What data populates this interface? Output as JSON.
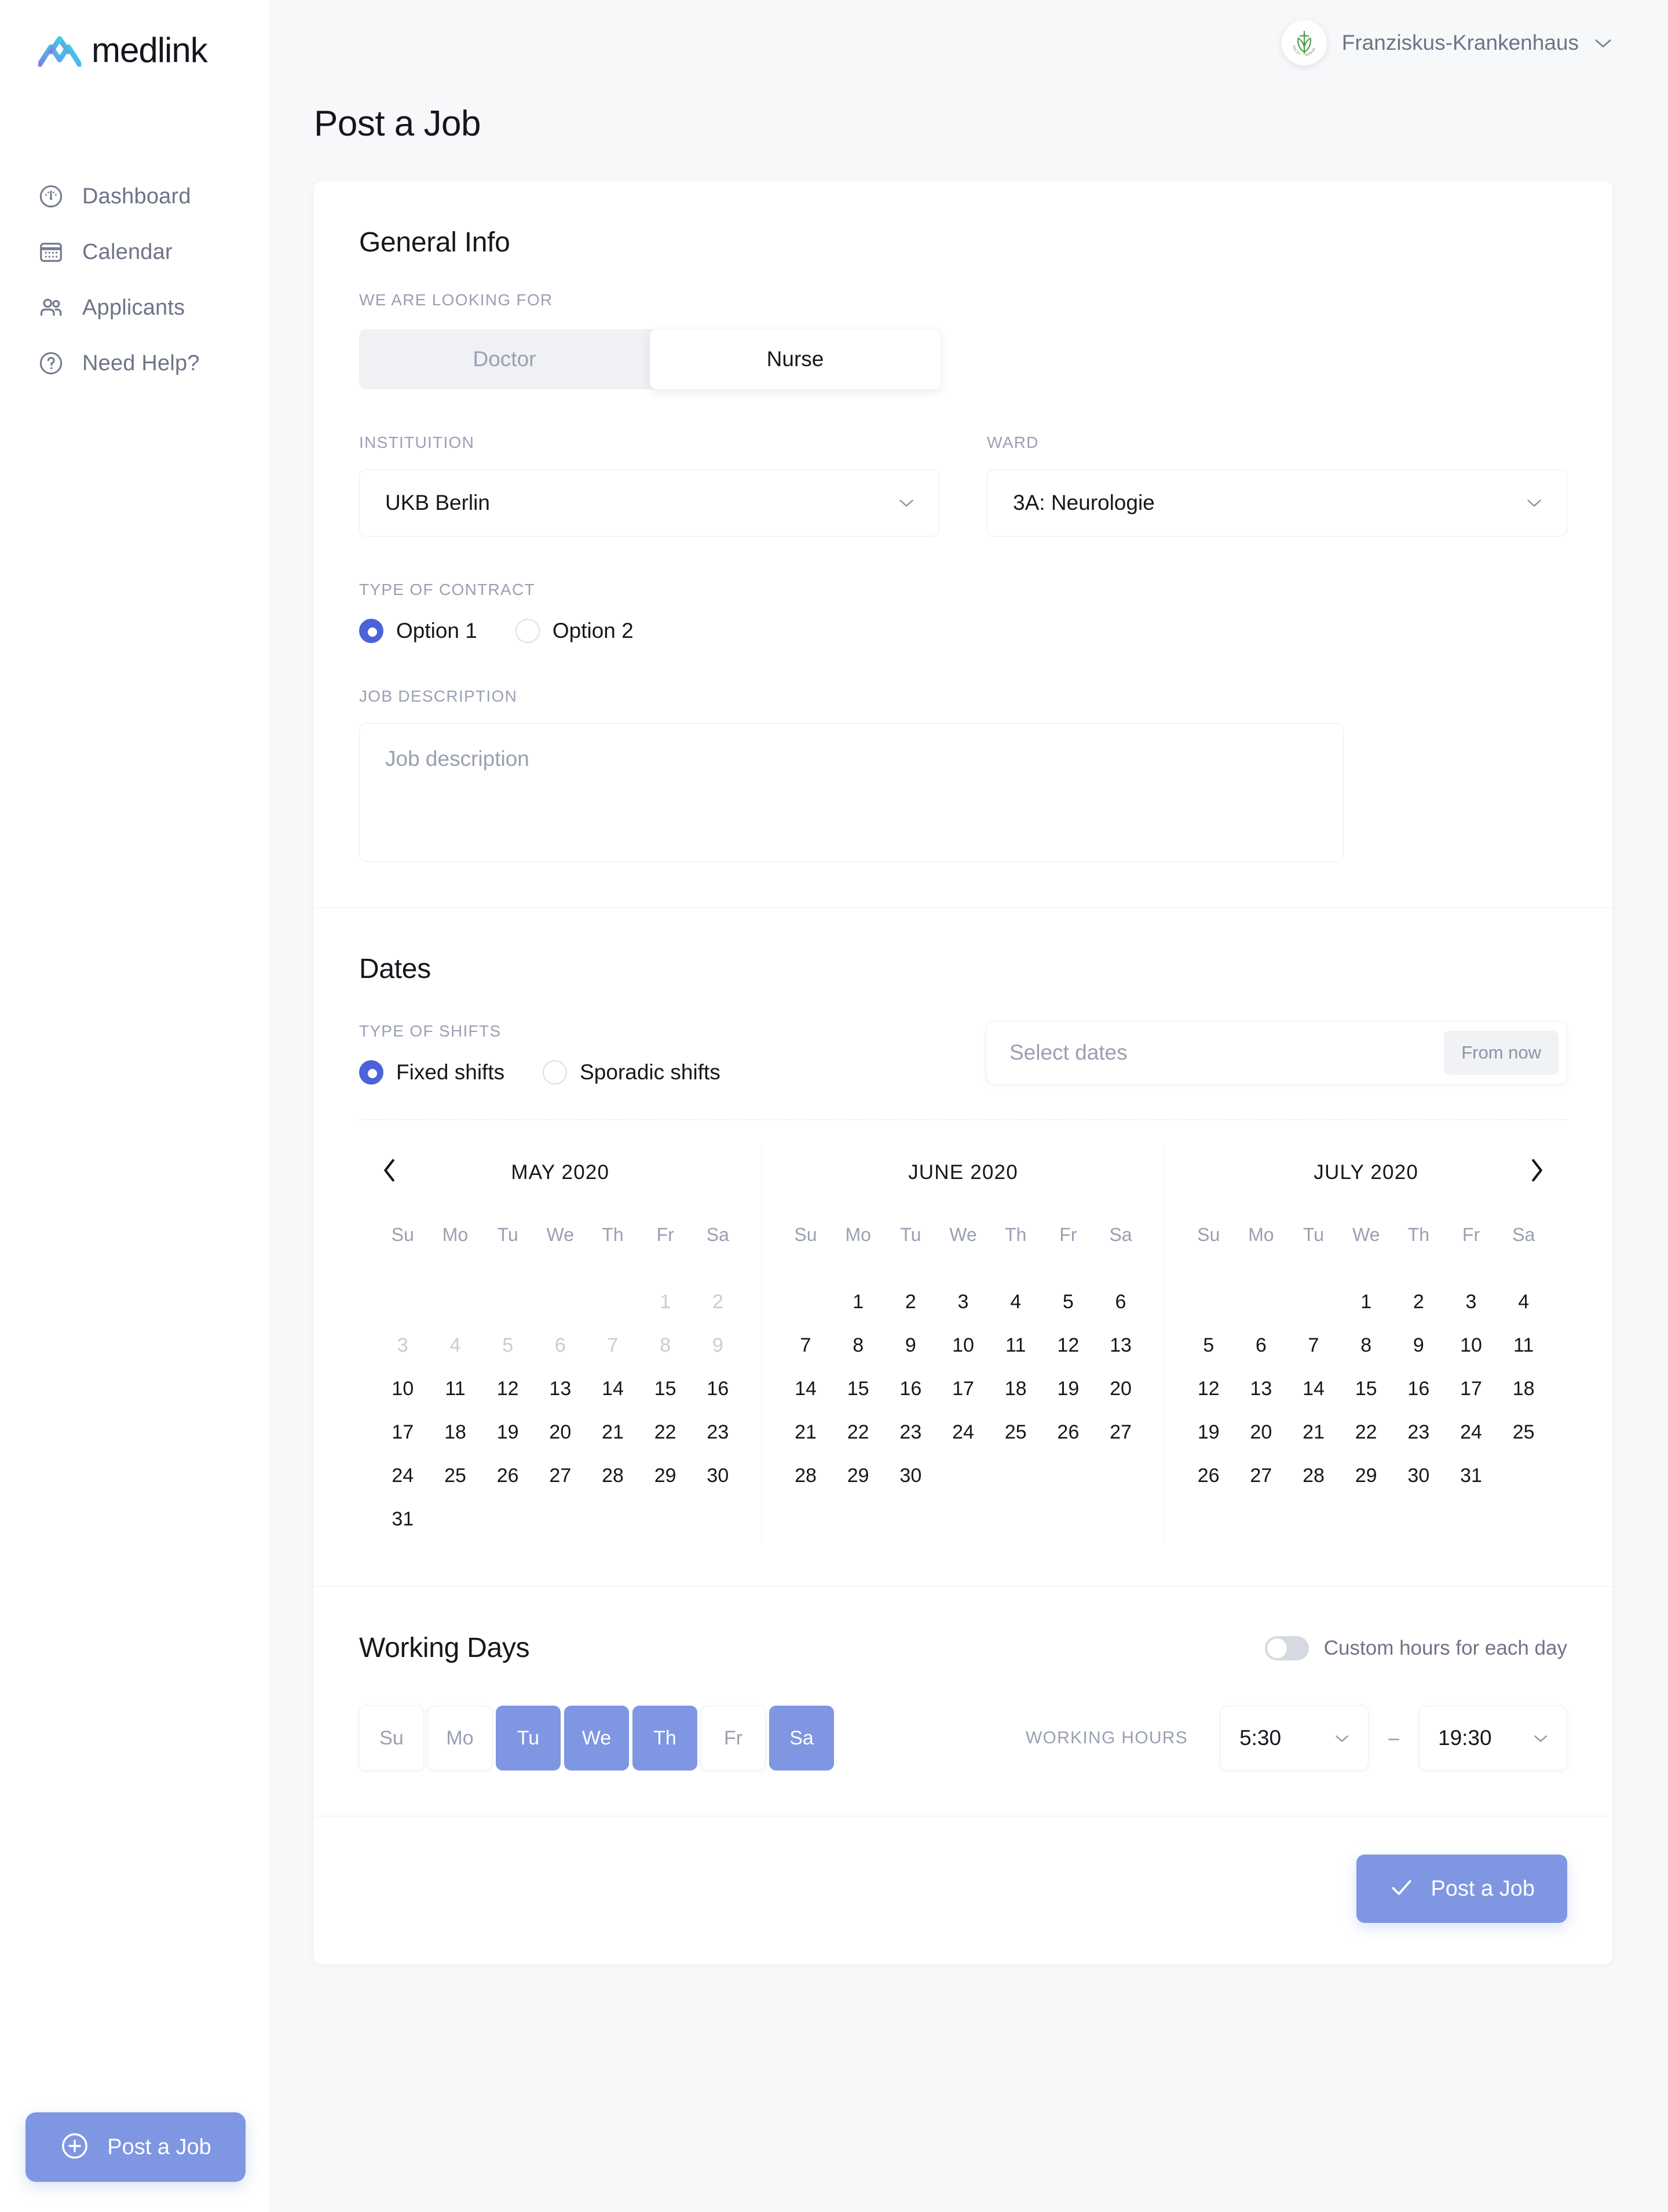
{
  "brand": {
    "name": "medlink",
    "accent": "#7f96e3",
    "logo_icon": "medlink-mountain-logo"
  },
  "sidebar": {
    "items": [
      {
        "label": "Dashboard",
        "icon": "gauge-icon"
      },
      {
        "label": "Calendar",
        "icon": "calendar-icon"
      },
      {
        "label": "Applicants",
        "icon": "users-icon"
      },
      {
        "label": "Need Help?",
        "icon": "question-circle-icon"
      }
    ],
    "post_job_label": "Post a Job",
    "post_job_icon": "plus-circle-icon"
  },
  "topbar": {
    "account_name": "Franziskus-Krankenhaus",
    "avatar_icon": "hospital-crest-avatar",
    "caret_icon": "chevron-down-icon"
  },
  "page": {
    "title": "Post a Job"
  },
  "general": {
    "section_title": "General Info",
    "looking_for_label": "WE ARE LOOKING FOR",
    "segments": [
      {
        "label": "Doctor",
        "active": false
      },
      {
        "label": "Nurse",
        "active": true
      }
    ],
    "institution_label": "INSTITUITION",
    "institution_value": "UKB Berlin",
    "ward_label": "WARD",
    "ward_value": "3A: Neurologie",
    "contract_label": "TYPE OF CONTRACT",
    "contract_options": [
      {
        "label": "Option 1",
        "selected": true
      },
      {
        "label": "Option 2",
        "selected": false
      }
    ],
    "description_label": "JOB DESCRIPTION",
    "description_placeholder": "Job description",
    "description_value": ""
  },
  "dates": {
    "section_title": "Dates",
    "shifts_label": "TYPE OF SHIFTS",
    "shift_options": [
      {
        "label": "Fixed shifts",
        "selected": true
      },
      {
        "label": "Sporadic shifts",
        "selected": false
      }
    ],
    "select_dates_placeholder": "Select dates",
    "from_now_label": "From now",
    "prev_icon": "chevron-left-icon",
    "next_icon": "chevron-right-icon",
    "dow": [
      "Su",
      "Mo",
      "Tu",
      "We",
      "Th",
      "Fr",
      "Sa"
    ],
    "months": [
      {
        "title": "MAY 2020",
        "lead_blanks": 5,
        "days": [
          {
            "n": 1,
            "muted": true
          },
          {
            "n": 2,
            "muted": true
          },
          {
            "n": 3,
            "muted": true
          },
          {
            "n": 4,
            "muted": true
          },
          {
            "n": 5,
            "muted": true
          },
          {
            "n": 6,
            "muted": true
          },
          {
            "n": 7,
            "muted": true
          },
          {
            "n": 8,
            "muted": true
          },
          {
            "n": 9,
            "muted": true
          },
          {
            "n": 10,
            "muted": false
          },
          {
            "n": 11,
            "muted": false
          },
          {
            "n": 12,
            "muted": false
          },
          {
            "n": 13,
            "muted": false
          },
          {
            "n": 14,
            "muted": false
          },
          {
            "n": 15,
            "muted": false
          },
          {
            "n": 16,
            "muted": false
          },
          {
            "n": 17,
            "muted": false
          },
          {
            "n": 18,
            "muted": false
          },
          {
            "n": 19,
            "muted": false
          },
          {
            "n": 20,
            "muted": false
          },
          {
            "n": 21,
            "muted": false
          },
          {
            "n": 22,
            "muted": false
          },
          {
            "n": 23,
            "muted": false
          },
          {
            "n": 24,
            "muted": false
          },
          {
            "n": 25,
            "muted": false
          },
          {
            "n": 26,
            "muted": false
          },
          {
            "n": 27,
            "muted": false
          },
          {
            "n": 28,
            "muted": false
          },
          {
            "n": 29,
            "muted": false
          },
          {
            "n": 30,
            "muted": false
          },
          {
            "n": 31,
            "muted": false
          }
        ]
      },
      {
        "title": "JUNE 2020",
        "lead_blanks": 1,
        "days": [
          {
            "n": 1,
            "muted": false
          },
          {
            "n": 2,
            "muted": false
          },
          {
            "n": 3,
            "muted": false
          },
          {
            "n": 4,
            "muted": false
          },
          {
            "n": 5,
            "muted": false
          },
          {
            "n": 6,
            "muted": false
          },
          {
            "n": 7,
            "muted": false
          },
          {
            "n": 8,
            "muted": false
          },
          {
            "n": 9,
            "muted": false
          },
          {
            "n": 10,
            "muted": false
          },
          {
            "n": 11,
            "muted": false
          },
          {
            "n": 12,
            "muted": false
          },
          {
            "n": 13,
            "muted": false
          },
          {
            "n": 14,
            "muted": false
          },
          {
            "n": 15,
            "muted": false
          },
          {
            "n": 16,
            "muted": false
          },
          {
            "n": 17,
            "muted": false
          },
          {
            "n": 18,
            "muted": false
          },
          {
            "n": 19,
            "muted": false
          },
          {
            "n": 20,
            "muted": false
          },
          {
            "n": 21,
            "muted": false
          },
          {
            "n": 22,
            "muted": false
          },
          {
            "n": 23,
            "muted": false
          },
          {
            "n": 24,
            "muted": false
          },
          {
            "n": 25,
            "muted": false
          },
          {
            "n": 26,
            "muted": false
          },
          {
            "n": 27,
            "muted": false
          },
          {
            "n": 28,
            "muted": false
          },
          {
            "n": 29,
            "muted": false
          },
          {
            "n": 30,
            "muted": false
          }
        ]
      },
      {
        "title": "JULY 2020",
        "lead_blanks": 3,
        "days": [
          {
            "n": 1,
            "muted": false
          },
          {
            "n": 2,
            "muted": false
          },
          {
            "n": 3,
            "muted": false
          },
          {
            "n": 4,
            "muted": false
          },
          {
            "n": 5,
            "muted": false
          },
          {
            "n": 6,
            "muted": false
          },
          {
            "n": 7,
            "muted": false
          },
          {
            "n": 8,
            "muted": false
          },
          {
            "n": 9,
            "muted": false
          },
          {
            "n": 10,
            "muted": false
          },
          {
            "n": 11,
            "muted": false
          },
          {
            "n": 12,
            "muted": false
          },
          {
            "n": 13,
            "muted": false
          },
          {
            "n": 14,
            "muted": false
          },
          {
            "n": 15,
            "muted": false
          },
          {
            "n": 16,
            "muted": false
          },
          {
            "n": 17,
            "muted": false
          },
          {
            "n": 18,
            "muted": false
          },
          {
            "n": 19,
            "muted": false
          },
          {
            "n": 20,
            "muted": false
          },
          {
            "n": 21,
            "muted": false
          },
          {
            "n": 22,
            "muted": false
          },
          {
            "n": 23,
            "muted": false
          },
          {
            "n": 24,
            "muted": false
          },
          {
            "n": 25,
            "muted": false
          },
          {
            "n": 26,
            "muted": false
          },
          {
            "n": 27,
            "muted": false
          },
          {
            "n": 28,
            "muted": false
          },
          {
            "n": 29,
            "muted": false
          },
          {
            "n": 30,
            "muted": false
          },
          {
            "n": 31,
            "muted": false
          }
        ]
      }
    ]
  },
  "working": {
    "section_title": "Working Days",
    "custom_hours_label": "Custom hours for each day",
    "custom_hours_on": false,
    "days": [
      {
        "label": "Su",
        "selected": false
      },
      {
        "label": "Mo",
        "selected": false
      },
      {
        "label": "Tu",
        "selected": true
      },
      {
        "label": "We",
        "selected": true
      },
      {
        "label": "Th",
        "selected": true
      },
      {
        "label": "Fr",
        "selected": false
      },
      {
        "label": "Sa",
        "selected": true
      }
    ],
    "hours_label": "WORKING HOURS",
    "start_time": "5:30",
    "end_time": "19:30",
    "separator": "–"
  },
  "footer": {
    "post_label": "Post a Job",
    "check_icon": "check-icon"
  }
}
